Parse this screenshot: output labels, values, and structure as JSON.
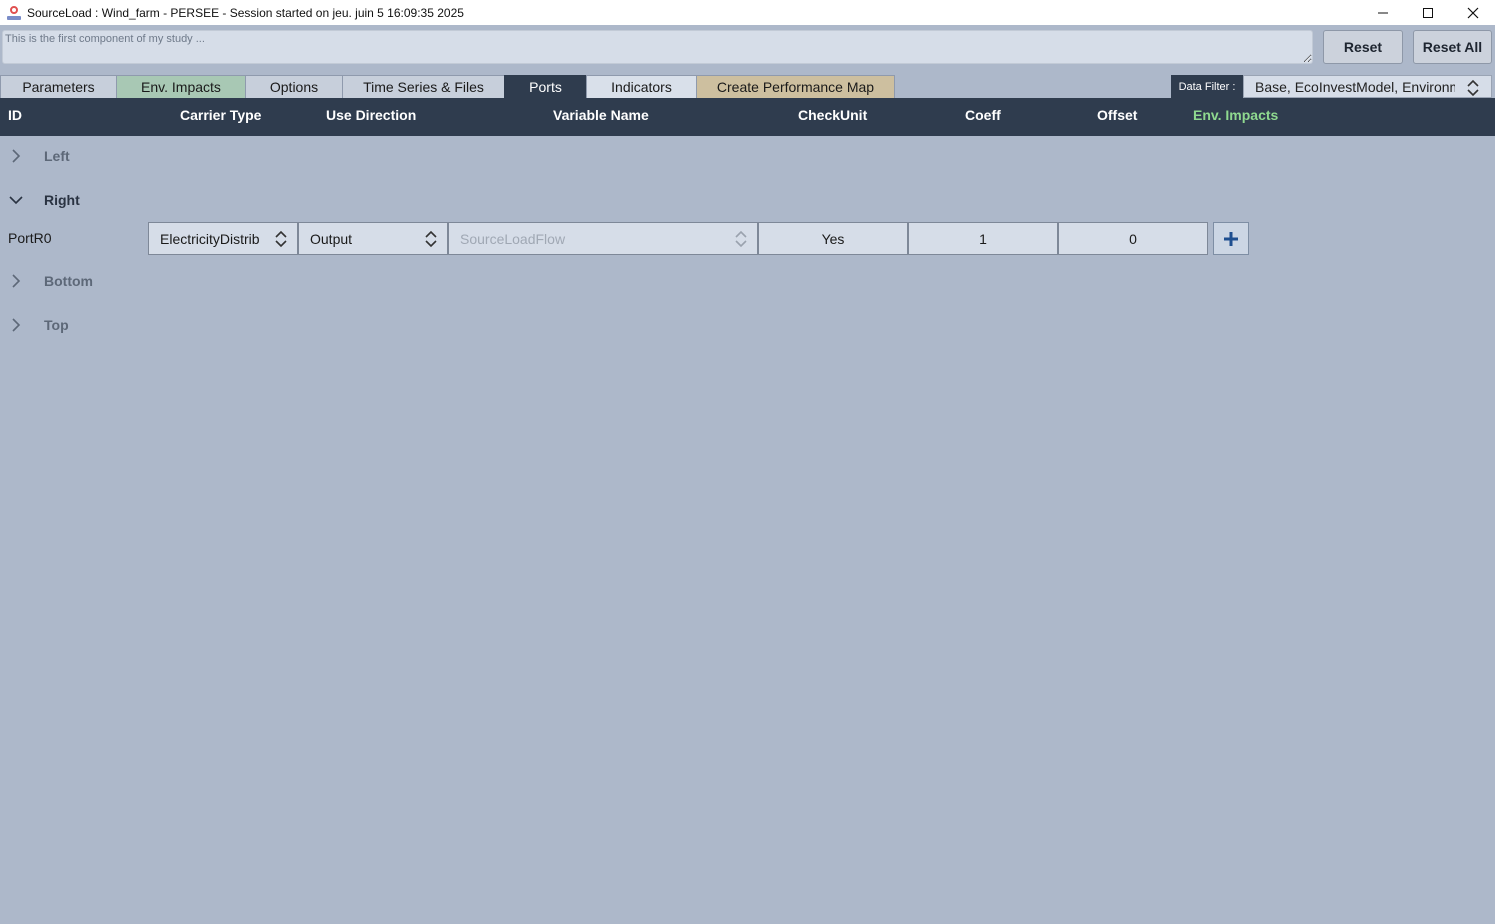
{
  "window": {
    "title": "SourceLoad : Wind_farm - PERSEE - Session started on jeu. juin 5 16:09:35 2025",
    "minimize": "—",
    "maximize": "☐",
    "close": "✕"
  },
  "description": {
    "value": "This is the first component of my study ..."
  },
  "buttons": {
    "reset": "Reset",
    "reset_all": "Reset All"
  },
  "tabs": [
    {
      "label": "Parameters"
    },
    {
      "label": "Env. Impacts"
    },
    {
      "label": "Options"
    },
    {
      "label": "Time Series & Files"
    },
    {
      "label": "Ports"
    },
    {
      "label": "Indicators"
    },
    {
      "label": "Create Performance Map"
    }
  ],
  "data_filter": {
    "label": "Data Filter :",
    "value": "Base, EcoInvestModel, Environm"
  },
  "columns": {
    "id": "ID",
    "carrier_type": "Carrier Type",
    "use_direction": "Use Direction",
    "variable_name": "Variable Name",
    "check_unit": "CheckUnit",
    "coeff": "Coeff",
    "offset": "Offset",
    "env_impacts": "Env. Impacts"
  },
  "colors": {
    "header_bg": "#2f3c4e",
    "body_bg": "#adb8ca",
    "env_impacts_header": "#8fd98f",
    "env_tab": "#a8c8b4",
    "perf_tab": "#cdbf9f"
  },
  "sections": {
    "left": {
      "label": "Left",
      "expanded": false
    },
    "right": {
      "label": "Right",
      "expanded": true
    },
    "bottom": {
      "label": "Bottom",
      "expanded": false
    },
    "top": {
      "label": "Top",
      "expanded": false
    }
  },
  "port": {
    "id": "PortR0",
    "carrier_type": "ElectricityDistrib",
    "use_direction": "Output",
    "variable_name": "SourceLoadFlow",
    "check_unit": "Yes",
    "coeff": "1",
    "offset": "0"
  }
}
